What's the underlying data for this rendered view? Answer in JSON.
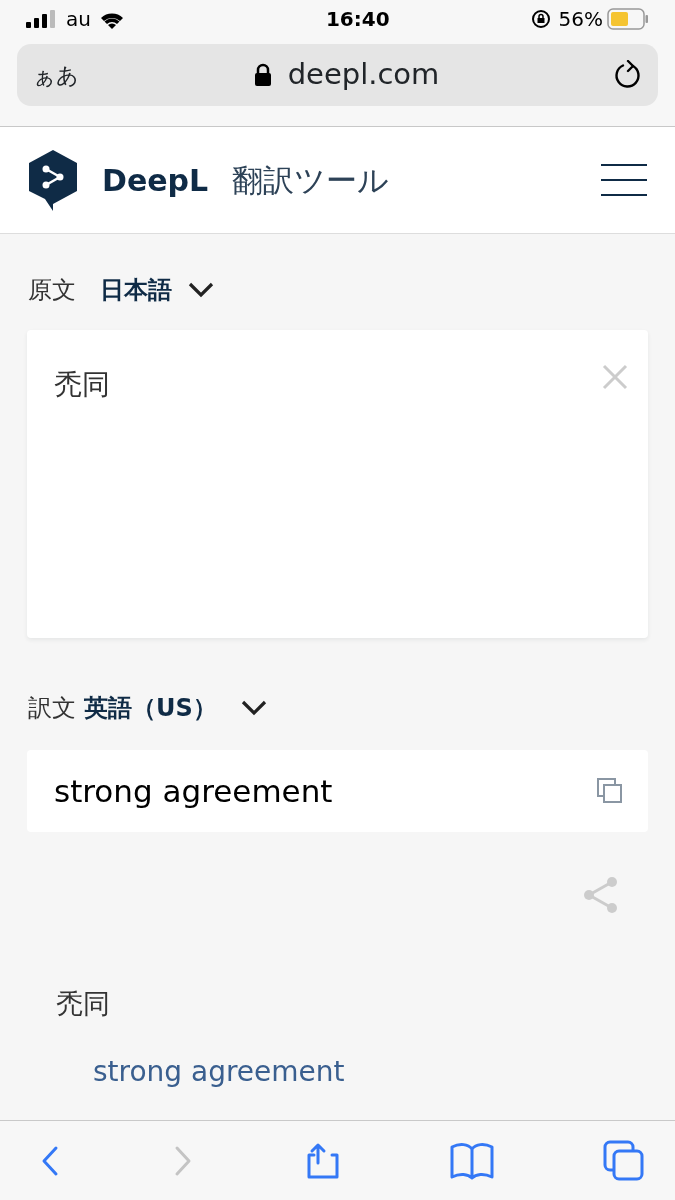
{
  "status_bar": {
    "carrier": "au",
    "time": "16:40",
    "battery": "56%"
  },
  "browser": {
    "text_size": "ぁあ",
    "address": "deepl.com"
  },
  "header": {
    "brand": "DeepL",
    "title": "翻訳ツール"
  },
  "source": {
    "label": "原文",
    "language": "日本語",
    "text": "禿同"
  },
  "target": {
    "label": "訳文",
    "language": "英語（US）",
    "text": "strong agreement"
  },
  "dictionary": {
    "term": "禿同",
    "translations": [
      "strong agreement"
    ]
  },
  "toolbar": [
    {
      "kind": "back",
      "disabled": false
    },
    {
      "kind": "forward",
      "disabled": true
    },
    {
      "kind": "share",
      "disabled": false
    },
    {
      "kind": "bookmarks",
      "disabled": false
    },
    {
      "kind": "tabs",
      "disabled": false
    }
  ]
}
